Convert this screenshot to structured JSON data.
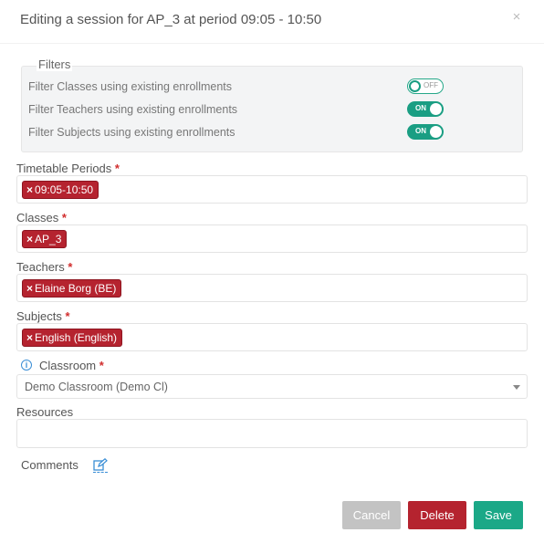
{
  "dialog": {
    "title": "Editing a session for AP_3 at period 09:05 - 10:50",
    "close_glyph": "×"
  },
  "filters": {
    "legend": "Filters",
    "items": [
      {
        "label": "Filter Classes using existing enrollments",
        "state": "OFF"
      },
      {
        "label": "Filter Teachers using existing enrollments",
        "state": "ON"
      },
      {
        "label": "Filter Subjects using existing enrollments",
        "state": "ON"
      }
    ]
  },
  "fields": {
    "timetable_periods": {
      "label": "Timetable Periods",
      "required": "*",
      "tag": "09:05-10:50"
    },
    "classes": {
      "label": "Classes",
      "required": "*",
      "tag": "AP_3"
    },
    "teachers": {
      "label": "Teachers",
      "required": "*",
      "tag": "Elaine Borg (BE)"
    },
    "subjects": {
      "label": "Subjects",
      "required": "*",
      "tag": "English (English)"
    },
    "classroom": {
      "label": "Classroom",
      "required": "*",
      "value": "Demo Classroom (Demo Cl)"
    },
    "resources": {
      "label": "Resources"
    },
    "comments": {
      "label": "Comments"
    }
  },
  "tag_remove_glyph": "×",
  "info_glyph": "i",
  "buttons": {
    "cancel": "Cancel",
    "delete": "Delete",
    "save": "Save"
  },
  "colors": {
    "tag": "#b5232f",
    "toggle_on": "#1a9e83",
    "save": "#1ba887",
    "delete": "#b5232f",
    "cancel": "#c3c3c3",
    "required": "#d12d2d"
  },
  "icons": {
    "close": "close-icon",
    "info": "info-icon",
    "edit": "edit-icon",
    "dropdown": "chevron-down-icon"
  }
}
